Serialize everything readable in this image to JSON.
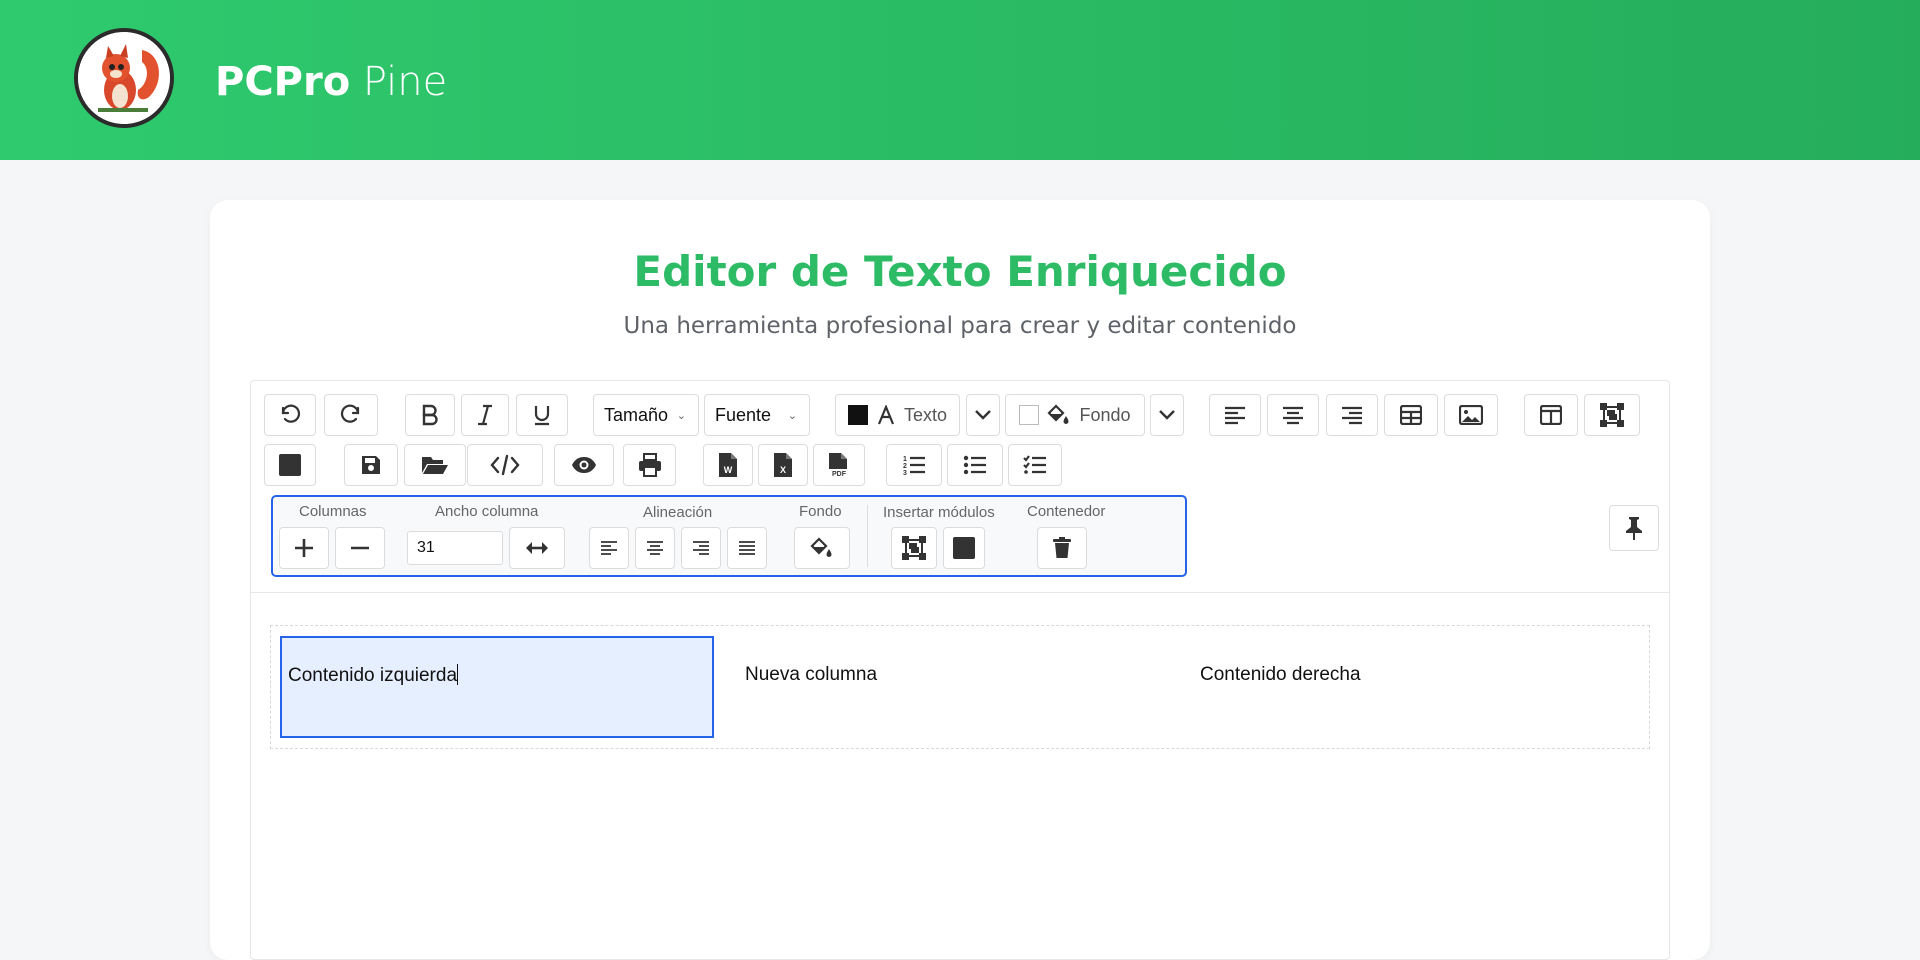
{
  "app": {
    "brand_bold": "PCPro",
    "brand_light": "Pine"
  },
  "page": {
    "title": "Editor de Texto Enriquecido",
    "subtitle": "Una herramienta profesional para crear y editar contenido"
  },
  "toolbar": {
    "size_label": "Tamaño",
    "font_label": "Fuente",
    "text_color_label": "Texto",
    "bg_color_label": "Fondo",
    "text_color": "#111111",
    "bg_color": "#ffffff"
  },
  "column_panel": {
    "columns_label": "Columnas",
    "width_label": "Ancho columna",
    "width_value": "31",
    "align_label": "Alineación",
    "background_label": "Fondo",
    "modules_label": "Insertar módulos",
    "container_label": "Contenedor"
  },
  "content": {
    "columns": [
      "Contenido izquierda",
      "Nueva columna",
      "Contenido derecha"
    ]
  },
  "colors": {
    "accent": "#2dbb66",
    "selection": "#2563eb"
  }
}
